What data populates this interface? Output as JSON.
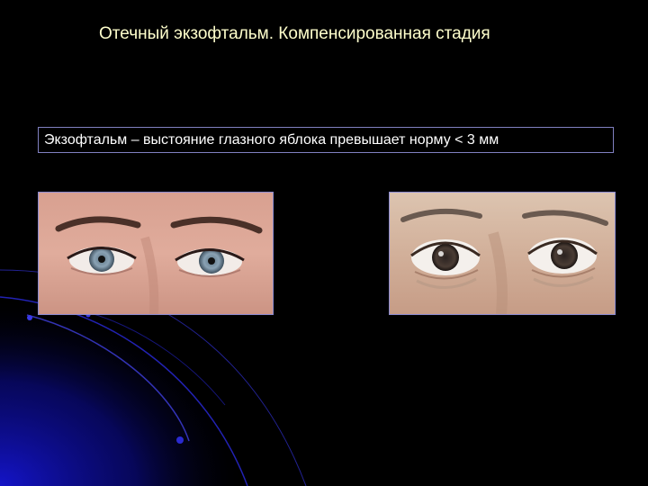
{
  "slide": {
    "title": "Отечный экзофтальм. Компенсированная стадия",
    "definition_text": "Экзофтальм – выстояние глазного яблока превышает норму  < 3 мм"
  },
  "images": [
    {
      "name": "eyes-photo-normal"
    },
    {
      "name": "eyes-photo-exophthalmos"
    }
  ],
  "colors": {
    "background": "#000000",
    "title": "#ffffcc",
    "text": "#ffffff",
    "frame": "#8080c0",
    "accent_blue": "#1a1acc"
  }
}
